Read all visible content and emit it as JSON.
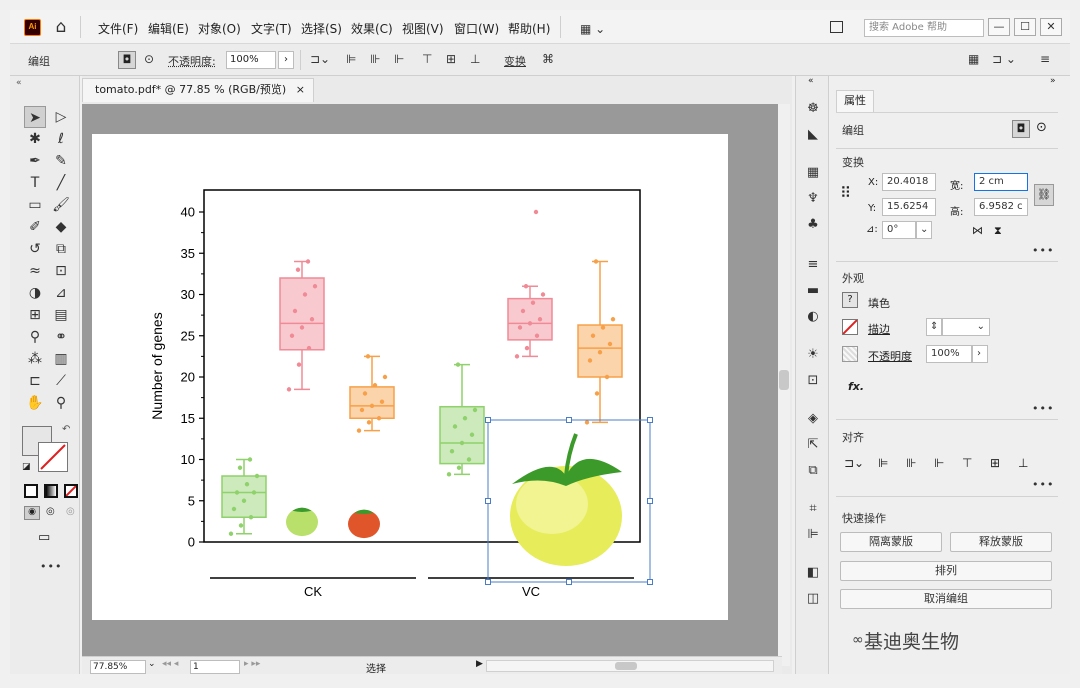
{
  "menubar": {
    "logo": "Ai",
    "items": [
      "文件(F)",
      "编辑(E)",
      "对象(O)",
      "文字(T)",
      "选择(S)",
      "效果(C)",
      "视图(V)",
      "窗口(W)",
      "帮助(H)"
    ],
    "search_placeholder": "搜索 Adobe 帮助",
    "min": "—",
    "max": "☐",
    "close": "✕"
  },
  "controlbar": {
    "mode_label": "编组",
    "opacity_label": "不透明度:",
    "opacity_value": "100%",
    "transform_label": "变换"
  },
  "document": {
    "tab_title": "tomato.pdf* @ 77.85 % (RGB/预览)",
    "tab_close": "×"
  },
  "status": {
    "zoom": "77.85%",
    "page": "1",
    "tool": "选择"
  },
  "properties": {
    "tab": "属性",
    "group_label": "编组",
    "transform": {
      "title": "变换",
      "x_label": "X:",
      "x_value": "20.4018",
      "y_label": "Y:",
      "y_value": "15.6254",
      "w_label": "宽:",
      "w_value": "2 cm",
      "h_label": "高:",
      "h_value": "6.9582 c",
      "angle_label": "⊿:",
      "angle_value": "0°"
    },
    "appearance": {
      "title": "外观",
      "fill_label": "填色",
      "stroke_label": "描边",
      "opacity_label": "不透明度",
      "opacity_value": "100%",
      "fx_label": "fx."
    },
    "align": {
      "title": "对齐"
    },
    "quick_actions": {
      "title": "快速操作",
      "release_clip": "隔离蒙版",
      "release_mask": "释放蒙版",
      "arrange": "排列",
      "ungroup": "取消编组"
    },
    "more": "•••"
  },
  "watermark": "基迪奥生物",
  "chart_data": {
    "type": "box",
    "ylabel": "Number of genes",
    "ylim": [
      0,
      40
    ],
    "yticks": [
      "0",
      "5",
      "10",
      "15",
      "20",
      "25",
      "30",
      "35",
      "40"
    ],
    "groups": [
      "CK",
      "VC"
    ],
    "series_colors": [
      "#8fd16a",
      "#f08a96",
      "#f7a048"
    ],
    "boxes": [
      {
        "group": "CK",
        "series": 0,
        "min": 1,
        "q1": 3,
        "median": 6,
        "q3": 8,
        "max": 10,
        "points": [
          1,
          2,
          3,
          4,
          5,
          6,
          6,
          7,
          8,
          9,
          10
        ]
      },
      {
        "group": "CK",
        "series": 1,
        "min": 18.5,
        "q1": 23.3,
        "median": 26.5,
        "q3": 32,
        "max": 34,
        "points": [
          18.5,
          21.5,
          23.5,
          25,
          26,
          27,
          28,
          30,
          31,
          33,
          34
        ]
      },
      {
        "group": "CK",
        "series": 2,
        "min": 13.5,
        "q1": 15,
        "median": 16.5,
        "q3": 18.8,
        "max": 22.5,
        "points": [
          13.5,
          14.5,
          15,
          16,
          16.5,
          17,
          18,
          19,
          20,
          22.5
        ]
      },
      {
        "group": "VC",
        "series": 0,
        "min": 8.2,
        "q1": 9.5,
        "median": 12,
        "q3": 16.4,
        "max": 21.5,
        "points": [
          8.2,
          9,
          10,
          11,
          12,
          13,
          14,
          15,
          16,
          21.5
        ]
      },
      {
        "group": "VC",
        "series": 1,
        "min": 22.5,
        "q1": 24.5,
        "median": 26.5,
        "q3": 29.5,
        "max": 31,
        "points": [
          22.5,
          23.5,
          25,
          26,
          26.5,
          27,
          28,
          29,
          30,
          31,
          40
        ]
      },
      {
        "group": "VC",
        "series": 2,
        "min": 14.5,
        "q1": 20,
        "median": 23.5,
        "q3": 26.3,
        "max": 34,
        "points": [
          14.5,
          18,
          20,
          22,
          23,
          24,
          25,
          26,
          27,
          34
        ]
      }
    ]
  }
}
